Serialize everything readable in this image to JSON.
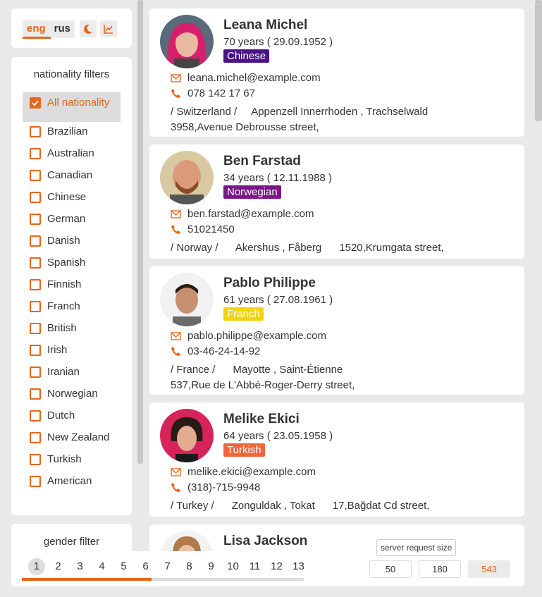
{
  "lang": {
    "eng": "eng",
    "rus": "rus"
  },
  "filters": {
    "title": "nationality filters",
    "items": [
      "All nationality",
      "Brazilian",
      "Australian",
      "Canadian",
      "Chinese",
      "German",
      "Danish",
      "Spanish",
      "Finnish",
      "Franch",
      "British",
      "Irish",
      "Iranian",
      "Norwegian",
      "Dutch",
      "New Zealand",
      "Turkish",
      "American"
    ]
  },
  "gender": {
    "title": "gender filter"
  },
  "users": [
    {
      "name": "Leana Michel",
      "age": "70 years ( 29.09.1952 )",
      "nat": "Chinese",
      "nat_color": "#4a1485",
      "email": "leana.michel@example.com",
      "phone": "078 142 17 67",
      "addr1": "/ Switzerland /     Appenzell Innerrhoden , Trachselwald",
      "addr2": "3958,Avenue Debrousse street,"
    },
    {
      "name": "Ben Farstad",
      "age": "34 years ( 12.11.1988 )",
      "nat": "Norwegian",
      "nat_color": "#7a1685",
      "email": "ben.farstad@example.com",
      "phone": "51021450",
      "addr1": "/ Norway /      Akershus , Fåberg      1520,Krumgata street,",
      "addr2": ""
    },
    {
      "name": "Pablo Philippe",
      "age": "61 years ( 27.08.1961 )",
      "nat": "Franch",
      "nat_color": "#f2d40c",
      "email": "pablo.philippe@example.com",
      "phone": "03-46-24-14-92",
      "addr1": "/ France /      Mayotte , Saint-Étienne",
      "addr2": "537,Rue de L'Abbé-Roger-Derry street,"
    },
    {
      "name": "Melike Ekici",
      "age": "64 years ( 23.05.1958 )",
      "nat": "Turkish",
      "nat_color": "#f2653c",
      "email": "melike.ekici@example.com",
      "phone": "(318)-715-9948",
      "addr1": "/ Turkey /      Zonguldak , Tokat      17,Bağdat Cd street,",
      "addr2": ""
    },
    {
      "name": "Lisa Jackson"
    }
  ],
  "pager": {
    "pages": [
      "1",
      "2",
      "3",
      "4",
      "5",
      "6",
      "7",
      "8",
      "9",
      "10",
      "11",
      "12",
      "13"
    ],
    "progress": 0.46,
    "tooltip": "server request size",
    "sizes": [
      "50",
      "180",
      "543"
    ]
  },
  "colors": {
    "accent": "#e8651a"
  }
}
